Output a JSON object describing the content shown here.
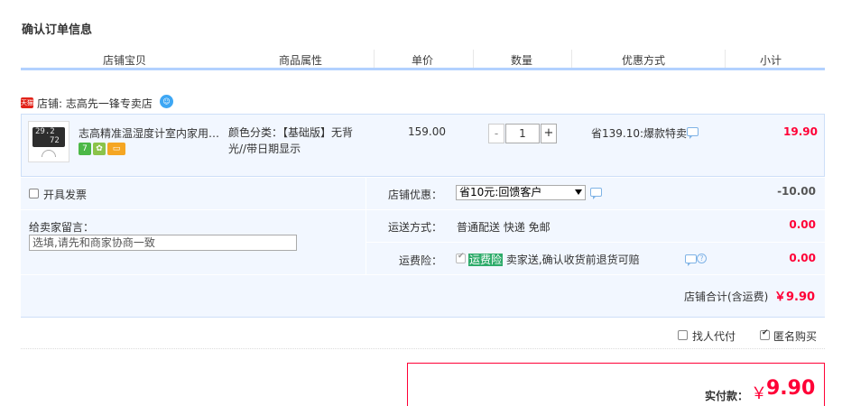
{
  "page": {
    "title": "确认订单信息"
  },
  "columns": [
    "店铺宝贝",
    "商品属性",
    "单价",
    "数量",
    "优惠方式",
    "小计"
  ],
  "shop": {
    "badge": "天猫",
    "label": "店铺:",
    "name": "志高先一锋专卖店"
  },
  "item": {
    "title": "志高精准温湿度计室内家用…",
    "lcd_top": "29.2",
    "lcd_bottom": "72",
    "attr_label": "颜色分类：",
    "attr_value": "【基础版】无背光//带日期显示",
    "price": "159.00",
    "quantity": "1",
    "qty_minus": "-",
    "qty_plus": "+",
    "discount": "省139.10:爆款特卖",
    "subtotal": "19.90",
    "service_icons": [
      "7",
      "✿",
      "▭"
    ]
  },
  "options": {
    "invoice_label": "开具发票",
    "message_label": "给卖家留言：",
    "message_placeholder": "选填,请先和商家协商一致",
    "shop_discount_label": "店铺优惠：",
    "shop_discount_value": "省10元:回馈客户",
    "shop_discount_amt": "-10.00",
    "shipping_label": "运送方式：",
    "shipping_value": "普通配送 快递 免邮",
    "shipping_amt": "0.00",
    "insurance_label": "运费险：",
    "insurance_highlight": "运费险",
    "insurance_text": "卖家送,确认收货前退货可赔",
    "insurance_amt": "0.00"
  },
  "shop_total": {
    "label": "店铺合计(含运费)",
    "amount": "￥9.90"
  },
  "extras": {
    "proxy_pay": "找人代付",
    "anonymous": "匿名购买"
  },
  "payment": {
    "label": "实付款：",
    "currency": "￥",
    "amount": "9.90"
  },
  "colors": {
    "accent": "#ff0036",
    "header_border": "#b2d1ff",
    "panel_bg": "#f2f7ff"
  }
}
